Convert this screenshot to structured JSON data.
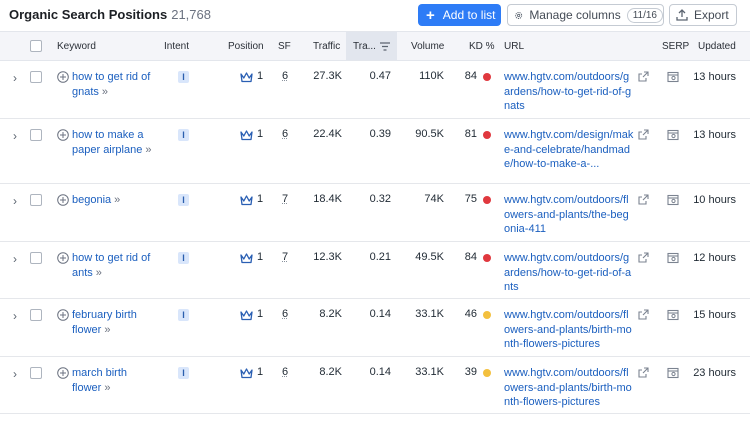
{
  "header": {
    "title": "Organic Search Positions",
    "count": "21,768",
    "add_to_list": "Add to list",
    "manage_columns": "Manage columns",
    "columns_badge": "11/16",
    "export": "Export"
  },
  "columns": {
    "keyword": "Keyword",
    "intent": "Intent",
    "position": "Position",
    "sf": "SF",
    "traffic": "Traffic",
    "traffic_share": "Tra...",
    "volume": "Volume",
    "kd": "KD %",
    "url": "URL",
    "serp": "SERP",
    "updated": "Updated"
  },
  "colors": {
    "accent": "#2e7cf6",
    "link": "#1b5fbf",
    "kd_hard": "#e0383e",
    "kd_medium": "#f3c03e"
  },
  "rows": [
    {
      "keyword": "how to get rid of gnats",
      "intent": "I",
      "position": "1",
      "sf": "6",
      "traffic": "27.3K",
      "share": "0.47",
      "volume": "110K",
      "kd": "84",
      "kd_color": "#e0383e",
      "url": "www.hgtv.com/outdoors/gardens/how-to-get-rid-of-gnats",
      "updated": "13 hours"
    },
    {
      "keyword": "how to make a paper airplane",
      "intent": "I",
      "position": "1",
      "sf": "6",
      "traffic": "22.4K",
      "share": "0.39",
      "volume": "90.5K",
      "kd": "81",
      "kd_color": "#e0383e",
      "url": "www.hgtv.com/design/make-and-celebrate/handmade/how-to-make-a-...",
      "updated": "13 hours"
    },
    {
      "keyword": "begonia",
      "intent": "I",
      "position": "1",
      "sf": "7",
      "traffic": "18.4K",
      "share": "0.32",
      "volume": "74K",
      "kd": "75",
      "kd_color": "#e0383e",
      "url": "www.hgtv.com/outdoors/flowers-and-plants/the-begonia-411",
      "updated": "10 hours"
    },
    {
      "keyword": "how to get rid of ants",
      "intent": "I",
      "position": "1",
      "sf": "7",
      "traffic": "12.3K",
      "share": "0.21",
      "volume": "49.5K",
      "kd": "84",
      "kd_color": "#e0383e",
      "url": "www.hgtv.com/outdoors/gardens/how-to-get-rid-of-ants",
      "updated": "12 hours"
    },
    {
      "keyword": "february birth flower",
      "intent": "I",
      "position": "1",
      "sf": "6",
      "traffic": "8.2K",
      "share": "0.14",
      "volume": "33.1K",
      "kd": "46",
      "kd_color": "#f3c03e",
      "url": "www.hgtv.com/outdoors/flowers-and-plants/birth-month-flowers-pictures",
      "updated": "15 hours"
    },
    {
      "keyword": "march birth flower",
      "intent": "I",
      "position": "1",
      "sf": "6",
      "traffic": "8.2K",
      "share": "0.14",
      "volume": "33.1K",
      "kd": "39",
      "kd_color": "#f3c03e",
      "url": "www.hgtv.com/outdoors/flowers-and-plants/birth-month-flowers-pictures",
      "updated": "23 hours"
    }
  ]
}
